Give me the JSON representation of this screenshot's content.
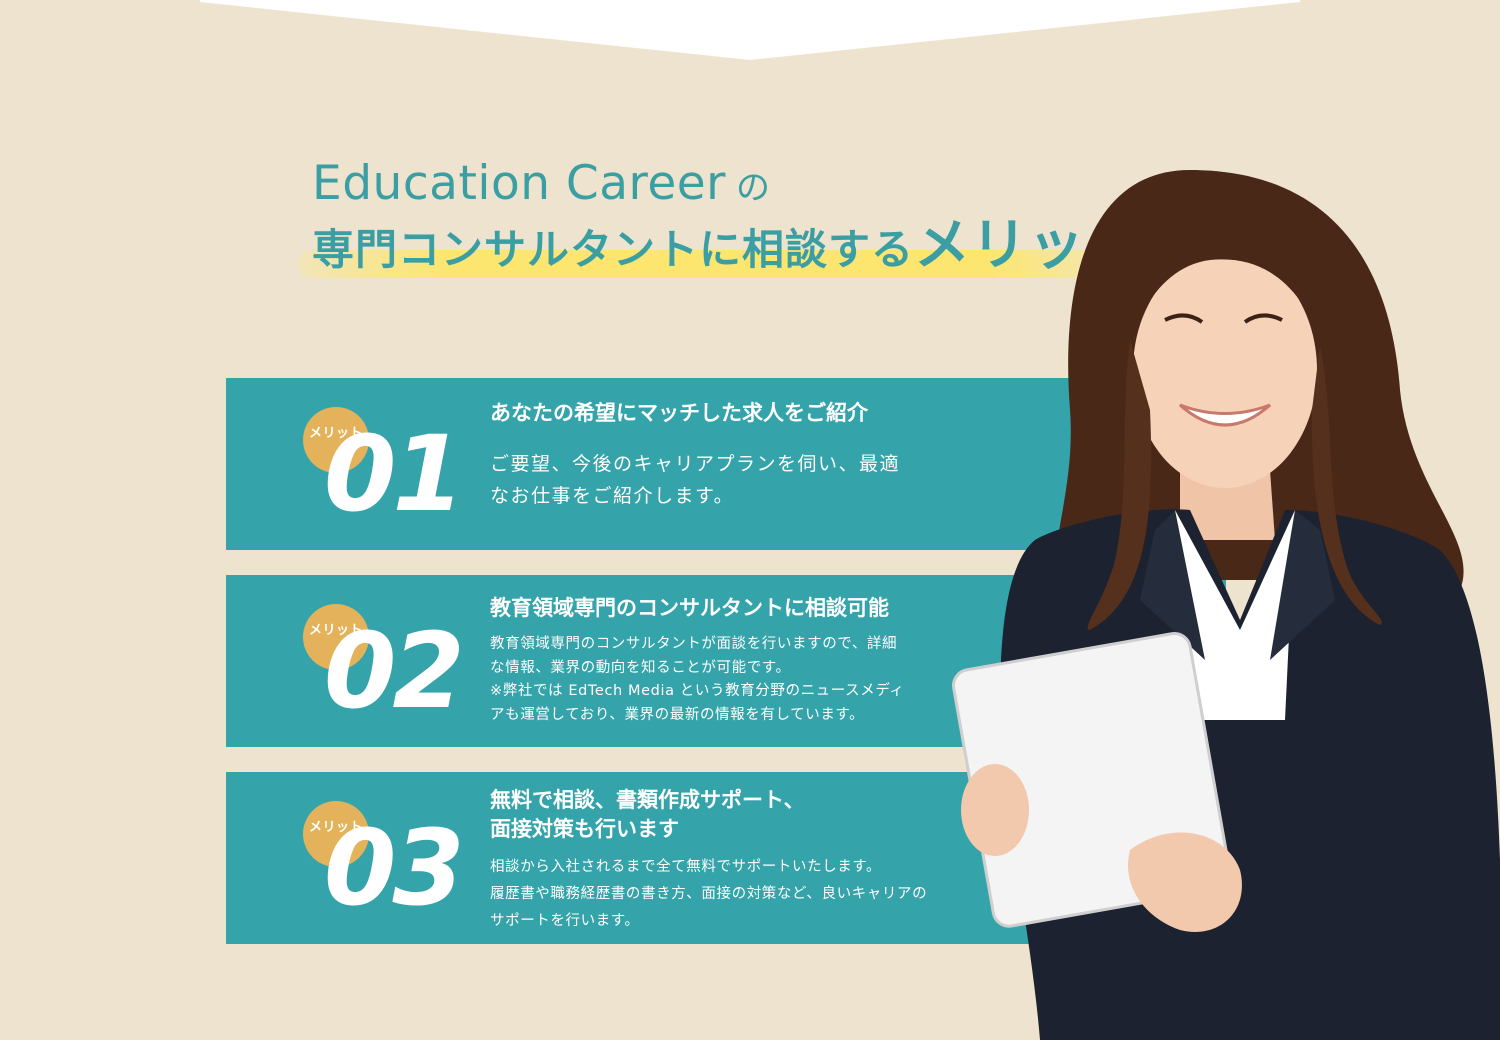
{
  "colors": {
    "background": "#ede3cf",
    "teal": "#35a3aa",
    "heading": "#3a9ea2",
    "badge": "#e3b25a",
    "highlight": "#ffe65f"
  },
  "heading": {
    "line1_brand": "Education Career",
    "line1_particle": "の",
    "line2_main": "専門コンサルタントに相談する",
    "line2_emphasis": "メリット"
  },
  "merits": [
    {
      "badge": "メリット",
      "number": "01",
      "title": "あなたの希望にマッチした求人をご紹介",
      "body": [
        "ご要望、今後のキャリアプランを伺い、最適",
        "なお仕事をご紹介します。"
      ]
    },
    {
      "badge": "メリット",
      "number": "02",
      "title": "教育領域専門のコンサルタントに相談可能",
      "body": [
        "教育領域専門のコンサルタントが面談を行いますので、詳細",
        "な情報、業界の動向を知ることが可能です。",
        "※弊社では EdTech Media という教育分野のニュースメディ",
        "アも運営しており、業界の最新の情報を有しています。"
      ]
    },
    {
      "badge": "メリット",
      "number": "03",
      "title_lines": [
        "無料で相談、書類作成サポート、",
        "面接対策も行います"
      ],
      "body": [
        "相談から入社されるまで全て無料でサポートいたします。",
        "履歴書や職務経歴書の書き方、面接の対策など、良いキャリアの",
        "サポートを行います。"
      ]
    }
  ],
  "image": {
    "subject": "smiling consultant holding a tablet"
  }
}
